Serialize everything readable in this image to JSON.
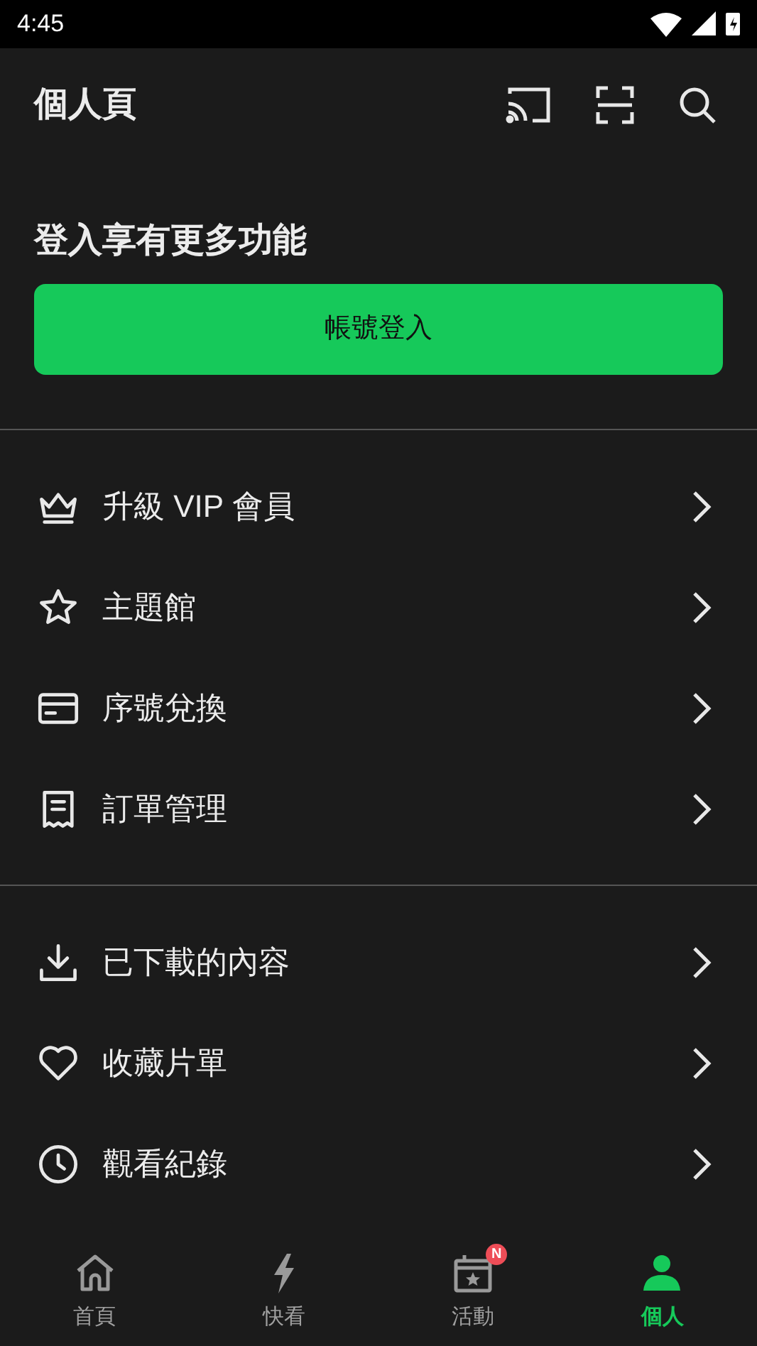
{
  "status_bar": {
    "time": "4:45"
  },
  "header": {
    "title": "個人頁"
  },
  "login": {
    "heading": "登入享有更多功能",
    "button": "帳號登入"
  },
  "menu_groups": [
    {
      "items": [
        {
          "kind": "crown",
          "label": "升級 VIP 會員"
        },
        {
          "kind": "star",
          "label": "主題館"
        },
        {
          "kind": "card",
          "label": "序號兌換"
        },
        {
          "kind": "receipt",
          "label": "訂單管理"
        }
      ]
    },
    {
      "items": [
        {
          "kind": "download",
          "label": "已下載的內容"
        },
        {
          "kind": "heart",
          "label": "收藏片單"
        },
        {
          "kind": "clock",
          "label": "觀看紀錄"
        }
      ]
    }
  ],
  "bottom_nav": [
    {
      "kind": "home",
      "label": "首頁",
      "selected": false
    },
    {
      "kind": "bolt",
      "label": "快看",
      "selected": false
    },
    {
      "kind": "calendar",
      "label": "活動",
      "selected": false,
      "badge": "N"
    },
    {
      "kind": "person",
      "label": "個人",
      "selected": true
    }
  ]
}
